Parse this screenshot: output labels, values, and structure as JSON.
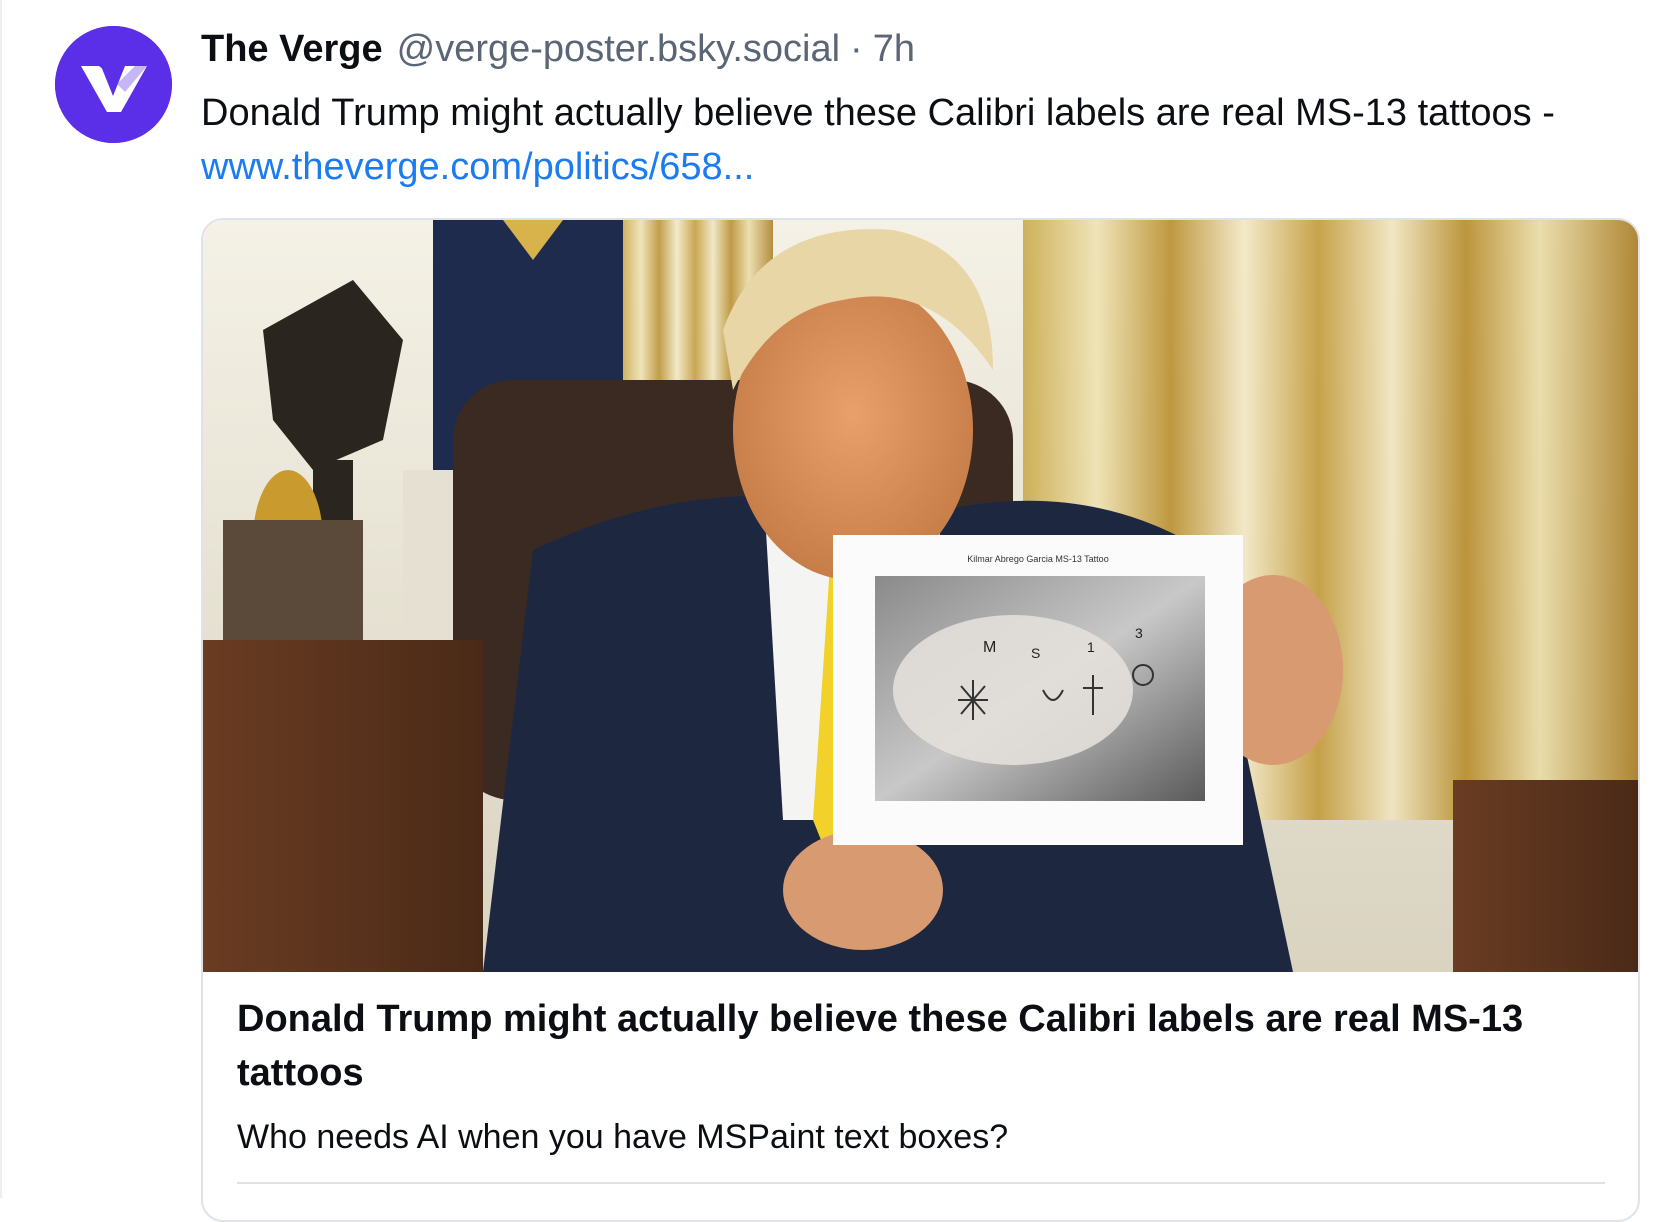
{
  "post": {
    "author_name": "The Verge",
    "author_handle": "@verge-poster.bsky.social",
    "separator": "·",
    "time": "7h",
    "avatar_icon": "verge-logo-icon",
    "text": "Donald Trump might actually believe these Calibri labels are real MS-13 tattoos - ",
    "link_text": "www.theverge.com/politics/658..."
  },
  "card": {
    "image_caption": "Kilmar Abrego Garcia MS-13 Tattoo",
    "finger_letters": [
      "M",
      "S",
      "1",
      "3"
    ],
    "title": "Donald Trump might actually believe these Calibri labels are real MS-13 tattoos",
    "description": "Who needs AI when you have MSPaint text boxes?"
  },
  "colors": {
    "avatar_bg": "#5b2ee8",
    "link": "#1a7cf0",
    "muted": "#5a6675",
    "border": "#dfe3e8"
  }
}
